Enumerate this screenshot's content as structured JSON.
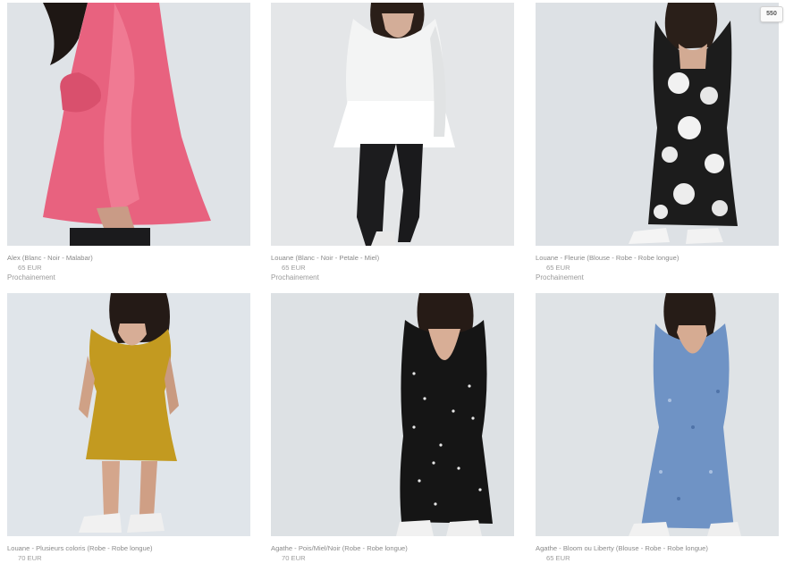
{
  "badge": {
    "label": "550"
  },
  "products": [
    {
      "title": "Alex (Blanc - Noir - Malabar)",
      "price": "65 EUR",
      "status": "Prochainement",
      "photo": "pink-peplum-blouse",
      "garment_color": "#e8627f"
    },
    {
      "title": "Louane (Blanc - Noir - Petale - Miel)",
      "price": "65 EUR",
      "status": "Prochainement",
      "photo": "white-peplum-blouse",
      "garment_color": "#f3f4f4"
    },
    {
      "title": "Louane - Fleurie (Blouse - Robe - Robe longue)",
      "price": "65 EUR",
      "status": "Prochainement",
      "photo": "black-floral-long-dress",
      "garment_color": "#1c1c1c"
    },
    {
      "title": "Louane - Plusieurs coloris (Robe - Robe longue)",
      "price": "70 EUR",
      "status": "",
      "photo": "mustard-short-dress",
      "garment_color": "#c39a20"
    },
    {
      "title": "Agathe - Pois/Miel/Noir (Robe - Robe longue)",
      "price": "70 EUR",
      "status": "",
      "photo": "black-polka-dot-midi-dress",
      "garment_color": "#151515"
    },
    {
      "title": "Agathe - Bloom ou Liberty (Blouse - Robe - Robe longue)",
      "price": "65 EUR",
      "status": "",
      "photo": "blue-floral-long-dress",
      "garment_color": "#6f93c5"
    }
  ]
}
